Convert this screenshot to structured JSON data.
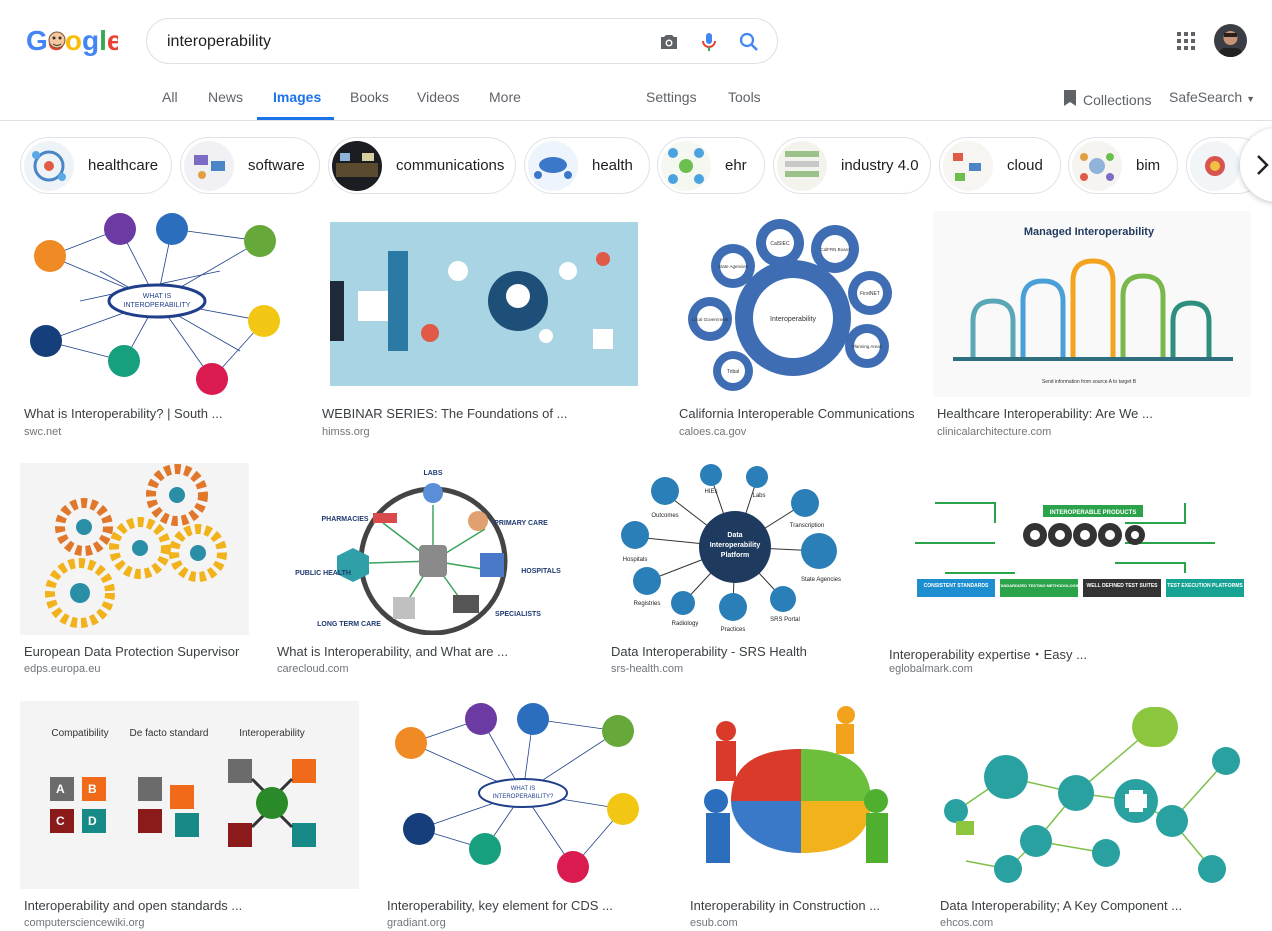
{
  "logo": {
    "text": "Google"
  },
  "search": {
    "query": "interoperability",
    "placeholder": ""
  },
  "tabs": [
    {
      "label": "All"
    },
    {
      "label": "News"
    },
    {
      "label": "Images"
    },
    {
      "label": "Books"
    },
    {
      "label": "Videos"
    },
    {
      "label": "More"
    },
    {
      "label": "Settings"
    },
    {
      "label": "Tools"
    }
  ],
  "toolbar": {
    "collections": "Collections",
    "safesearch": "SafeSearch"
  },
  "chips": [
    {
      "label": "healthcare"
    },
    {
      "label": "software"
    },
    {
      "label": "communications"
    },
    {
      "label": "health"
    },
    {
      "label": "ehr"
    },
    {
      "label": "industry 4.0"
    },
    {
      "label": "cloud"
    },
    {
      "label": "bim"
    }
  ],
  "results": [
    {
      "title": "What is Interoperability? | South ...",
      "source": "swc.net",
      "image_text": [
        "WHAT IS",
        "INTEROPERABILITY"
      ]
    },
    {
      "title": "WEBINAR SERIES: The Foundations of ...",
      "source": "himss.org"
    },
    {
      "title": "California Interoperable Communications",
      "source": "caloes.ca.gov",
      "image_text": [
        "Interoperability",
        "CalSIEC",
        "CalFRN Board",
        "FirstNET",
        "Planning Areas",
        "Tribal",
        "Local Government",
        "State Agencies"
      ]
    },
    {
      "title": "Healthcare Interoperability: Are We ...",
      "source": "clinicalarchitecture.com",
      "image_text": [
        "Managed Interoperability",
        "Send information from source A to target B"
      ]
    },
    {
      "title": "European Data Protection Supervisor",
      "source": "edps.europa.eu"
    },
    {
      "title": "What is Interoperability, and What are ...",
      "source": "carecloud.com",
      "image_text": [
        "LABS",
        "PHARMACIES",
        "PRIMARY CARE",
        "PUBLIC HEALTH",
        "HOSPITALS",
        "LONG TERM CARE",
        "SPECIALISTS"
      ]
    },
    {
      "title": "Data Interoperability - SRS Health",
      "source": "srs-health.com",
      "image_text": [
        "Data",
        "Interoperability",
        "Platform",
        "HIEs",
        "Labs",
        "Outcomes",
        "Transcription",
        "Hospitals",
        "State Agencies",
        "Registries",
        "Radiology",
        "Practices",
        "SRS Portal"
      ]
    },
    {
      "title": "Interoperability expertise・Easy ...",
      "source": "eglobalmark.com",
      "image_text": [
        "INTEROPERABLE PRODUCTS",
        "CONSISTENT STANDARDS",
        "STANDARDIZED TESTING METHODOLOGIES",
        "WELL DEFINED TEST SUITES",
        "TEST EXECUTION PLATFORMS"
      ]
    },
    {
      "title": "Interoperability and open standards ...",
      "source": "computersciencewiki.org",
      "image_text": [
        "Compatibility",
        "De facto standard",
        "Interoperability",
        "A",
        "B",
        "C",
        "D"
      ]
    },
    {
      "title": "Interoperability, key element for CDS ...",
      "source": "gradiant.org",
      "image_text": [
        "WHAT IS",
        "INTEROPERABILITY?"
      ]
    },
    {
      "title": "Interoperability in Construction ...",
      "source": "esub.com"
    },
    {
      "title": "Data Interoperability; A Key Component ...",
      "source": "ehcos.com"
    }
  ],
  "colors": {
    "accent": "#1a73e8",
    "text": "#202124",
    "secondary": "#5f6368",
    "border": "#dfe1e5"
  }
}
